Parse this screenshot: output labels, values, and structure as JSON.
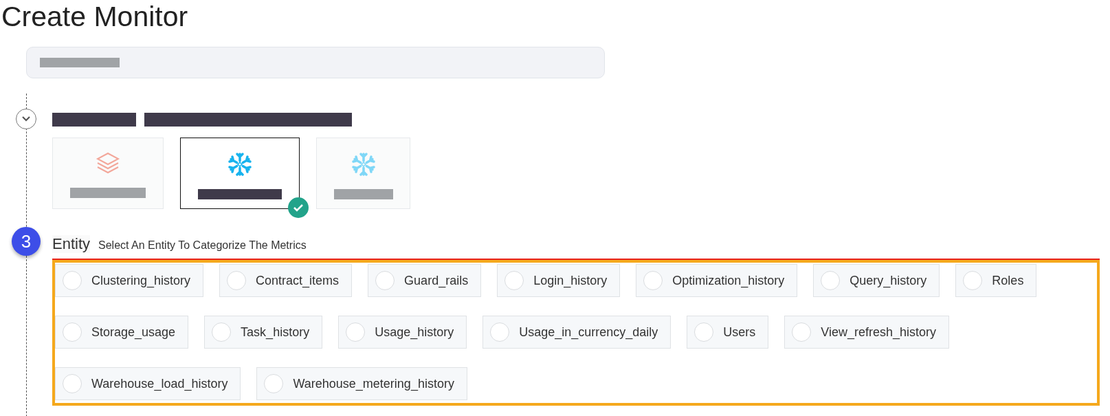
{
  "title": "Create Monitor",
  "source_section": {
    "expanded": true
  },
  "sources": [
    {
      "kind": "layers",
      "selected": false
    },
    {
      "kind": "snowflake",
      "selected": true
    },
    {
      "kind": "snowflake",
      "selected": false
    }
  ],
  "step": {
    "number": "3",
    "label": "Entity",
    "description": "Select An Entity To Categorize The Metrics"
  },
  "entities": [
    {
      "label": "Clustering_history",
      "selected": false
    },
    {
      "label": "Contract_items",
      "selected": false
    },
    {
      "label": "Guard_rails",
      "selected": false
    },
    {
      "label": "Login_history",
      "selected": false
    },
    {
      "label": "Optimization_history",
      "selected": false
    },
    {
      "label": "Query_history",
      "selected": false
    },
    {
      "label": "Roles",
      "selected": false
    },
    {
      "label": "Storage_usage",
      "selected": false
    },
    {
      "label": "Task_history",
      "selected": false
    },
    {
      "label": "Usage_history",
      "selected": false
    },
    {
      "label": "Usage_in_currency_daily",
      "selected": false
    },
    {
      "label": "Users",
      "selected": false
    },
    {
      "label": "View_refresh_history",
      "selected": false
    },
    {
      "label": "Warehouse_load_history",
      "selected": false
    },
    {
      "label": "Warehouse_metering_history",
      "selected": false
    }
  ]
}
